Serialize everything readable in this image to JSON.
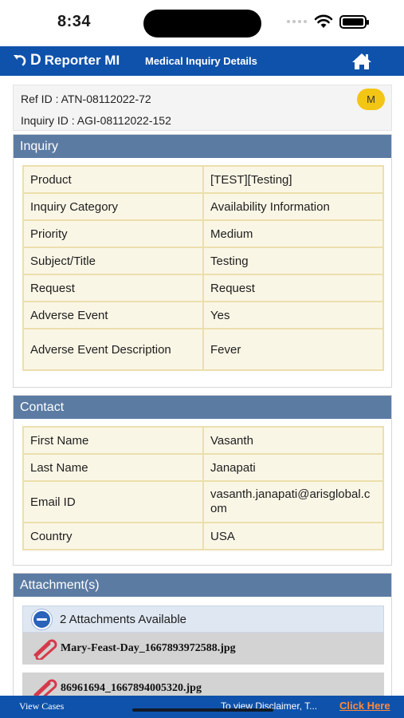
{
  "status": {
    "time": "8:34"
  },
  "header": {
    "brand_name": "Reporter MI",
    "brand_logo": "D",
    "title": "Medical Inquiry Details"
  },
  "ids": {
    "ref": "Ref ID : ATN-08112022-72",
    "inquiry": "Inquiry ID : AGI-08112022-152",
    "avatar": "M"
  },
  "inquiry": {
    "title": "Inquiry",
    "rows": [
      {
        "label": "Product",
        "value": "[TEST][Testing]"
      },
      {
        "label": "Inquiry Category",
        "value": "Availability Information"
      },
      {
        "label": "Priority",
        "value": "Medium"
      },
      {
        "label": "Subject/Title",
        "value": "Testing"
      },
      {
        "label": "Request",
        "value": "Request"
      },
      {
        "label": "Adverse Event",
        "value": "Yes"
      },
      {
        "label": "Adverse Event Description",
        "value": "Fever"
      }
    ]
  },
  "contact": {
    "title": "Contact",
    "rows": [
      {
        "label": "First Name",
        "value": "Vasanth"
      },
      {
        "label": "Last Name",
        "value": "Janapati"
      },
      {
        "label": "Email ID",
        "value": "vasanth.janapati@arisglobal.com"
      },
      {
        "label": "Country",
        "value": "USA"
      }
    ]
  },
  "attachments": {
    "title": "Attachment(s)",
    "count_label": "2 Attachments Available",
    "files": [
      "Mary-Feast-Day_1667893972588.jpg",
      "86961694_1667894005320.jpg"
    ]
  },
  "footer": {
    "view_cases": "View Cases",
    "disclaimer": "To view Disclaimer, T...",
    "click_here": "Click Here"
  },
  "icons": {
    "back": "back-arrow-icon",
    "home": "home-icon",
    "attachment": "paperclip-icon",
    "collapse": "minus-icon"
  },
  "colors": {
    "header": "#0f52ab",
    "section_head": "#5b7ba3",
    "cell_bg": "#faf6e6",
    "cell_border": "#ebdfad",
    "avatar": "#f3c515",
    "link": "#ff8a3c"
  }
}
